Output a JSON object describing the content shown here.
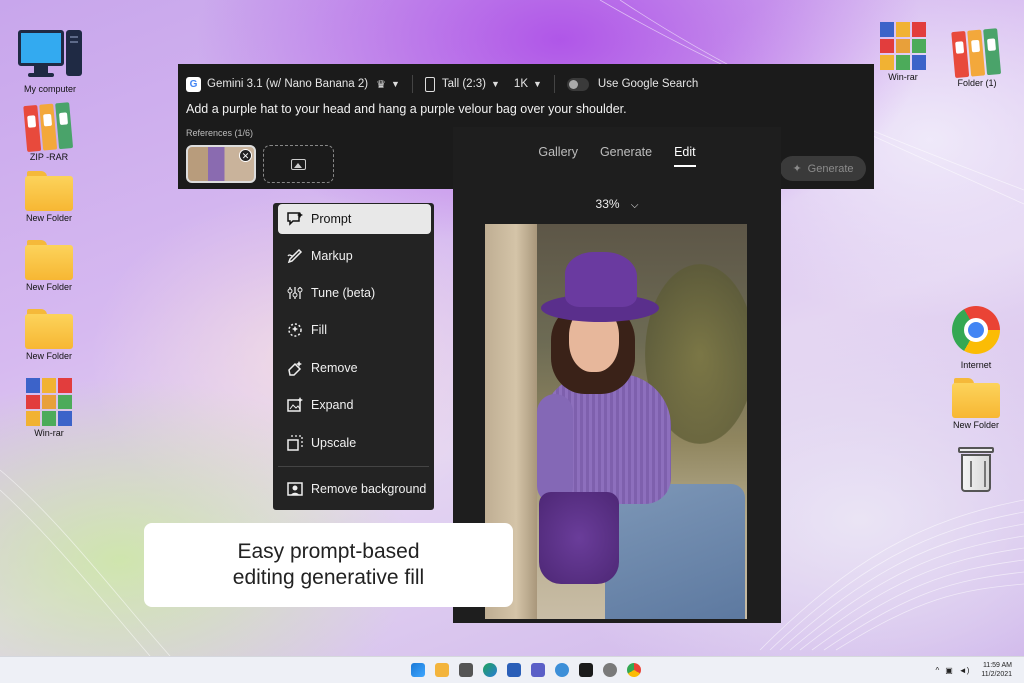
{
  "desktop": {
    "left_icons": [
      {
        "label": "My computer",
        "icon": "computer-icon"
      },
      {
        "label": "ZIP -RAR",
        "icon": "binders-icon"
      },
      {
        "label": "New Folder",
        "icon": "folder-icon"
      },
      {
        "label": "New Folder",
        "icon": "folder-icon"
      },
      {
        "label": "New Folder",
        "icon": "folder-icon"
      },
      {
        "label": "Win-rar",
        "icon": "winrar-icon"
      }
    ],
    "right_icons": [
      {
        "label": "Win-rar",
        "icon": "winrar-icon"
      },
      {
        "label": "Folder (1)",
        "icon": "binders-icon"
      },
      {
        "label": "Internet",
        "icon": "chrome-icon"
      },
      {
        "label": "New Folder",
        "icon": "folder-icon"
      },
      {
        "label": "",
        "icon": "recycle-bin-icon"
      }
    ]
  },
  "promptbar": {
    "model": "Gemini 3.1 (w/ Nano Banana 2)",
    "model_logo": "G",
    "aspect": "Tall (2:3)",
    "resolution": "1K",
    "google_search_label": "Use Google Search",
    "google_search_on": false,
    "prompt_text": "Add a purple hat to your head and hang a purple velour bag over your shoulder.",
    "references_label": "References (1/6)",
    "generate_label": "Generate"
  },
  "editor": {
    "tabs": [
      {
        "label": "Gallery",
        "active": false
      },
      {
        "label": "Generate",
        "active": false
      },
      {
        "label": "Edit",
        "active": true
      }
    ],
    "zoom": "33%"
  },
  "tools": [
    {
      "label": "Prompt",
      "icon": "prompt-icon",
      "selected": true
    },
    {
      "label": "Markup",
      "icon": "markup-icon",
      "selected": false
    },
    {
      "label": "Tune (beta)",
      "icon": "tune-icon",
      "selected": false
    },
    {
      "label": "Fill",
      "icon": "fill-icon",
      "selected": false
    },
    {
      "label": "Remove",
      "icon": "remove-icon",
      "selected": false
    },
    {
      "label": "Expand",
      "icon": "expand-icon",
      "selected": false
    },
    {
      "label": "Upscale",
      "icon": "upscale-icon",
      "selected": false
    },
    {
      "label": "Remove background",
      "icon": "remove-background-icon",
      "selected": false
    }
  ],
  "caption": {
    "line1": "Easy prompt-based",
    "line2": "editing generative fill"
  },
  "taskbar": {
    "time": "11:59 AM",
    "date": "11/2/2021",
    "tray_chevron": "^"
  },
  "colors": {
    "panel_bg": "#1b1b1b",
    "selected_tool_bg": "#e8e8e8",
    "hat_purple": "#6a3aa0"
  }
}
